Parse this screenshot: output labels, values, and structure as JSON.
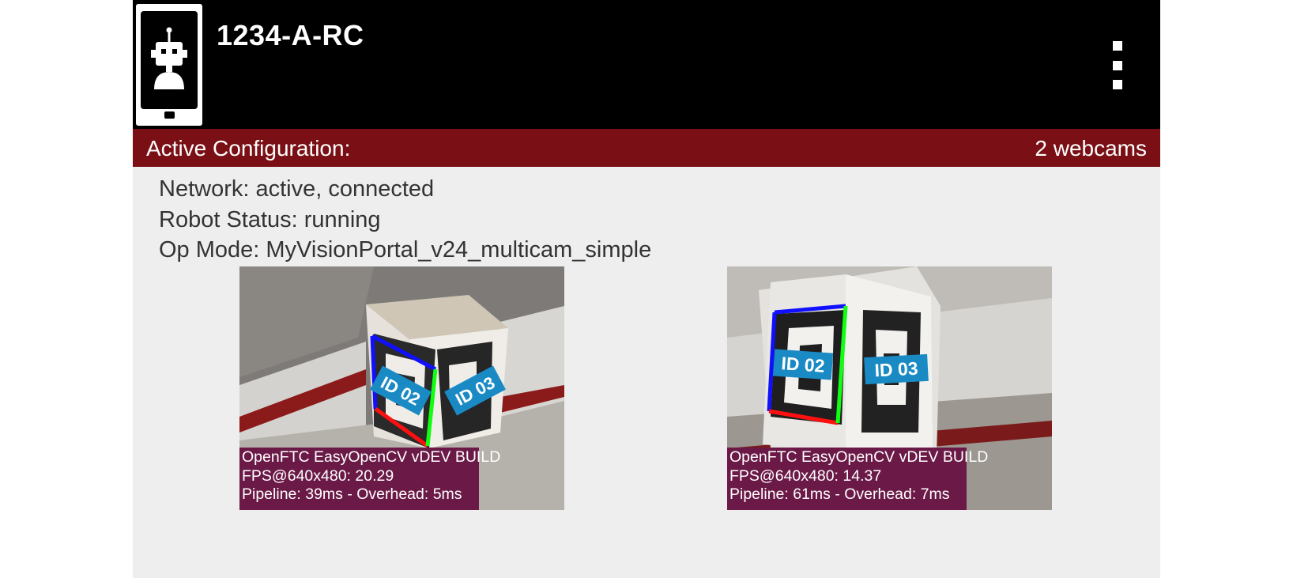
{
  "header": {
    "title": "1234-A-RC",
    "icon": "robot-controller-icon",
    "menu_icon": "overflow-menu-icon"
  },
  "config_bar": {
    "label": "Active Configuration:",
    "value": "2 webcams",
    "color": "#7a1015"
  },
  "status": {
    "network": "Network: active, connected",
    "robot_status": "Robot Status: running",
    "op_mode": "Op Mode: MyVisionPortal_v24_multicam_simple"
  },
  "cameras": [
    {
      "stats": {
        "line1": "OpenFTC EasyOpenCV vDEV BUILD",
        "line2": "FPS@640x480: 20.29",
        "line3": "Pipeline: 39ms - Overhead: 5ms"
      },
      "tags": [
        "ID 02",
        "ID 03"
      ]
    },
    {
      "stats": {
        "line1": "OpenFTC EasyOpenCV vDEV BUILD",
        "line2": "FPS@640x480: 14.37",
        "line3": "Pipeline: 61ms - Overhead: 7ms"
      },
      "tags": [
        "ID 02",
        "ID 03"
      ]
    }
  ],
  "colors": {
    "header_bg": "#000000",
    "body_bg": "#eeeeee",
    "overlay_bg": "#6b1a47",
    "tag_label_bg": "#1a8ac4"
  }
}
